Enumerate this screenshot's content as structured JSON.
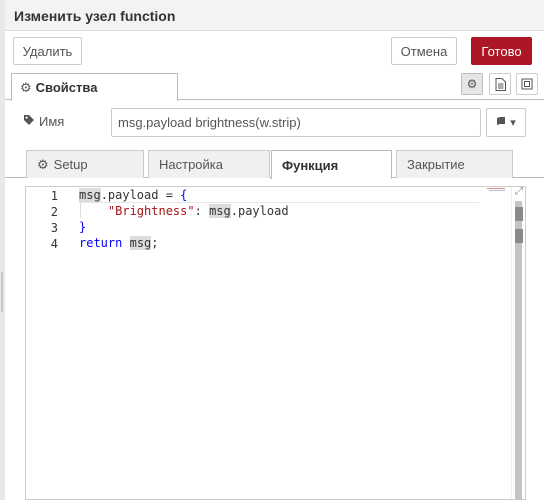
{
  "header": {
    "title": "Изменить узел function"
  },
  "toolbar": {
    "delete_label": "Удалить",
    "cancel_label": "Отмена",
    "done_label": "Готово"
  },
  "tabs": {
    "properties_label": "Свойства"
  },
  "properties": {
    "name_label": "Имя",
    "name_value": "msg.payload brightness(w.strip)"
  },
  "subtabs": [
    {
      "label": "Setup"
    },
    {
      "label": "Настройка"
    },
    {
      "label": "Функция"
    },
    {
      "label": "Закрытие"
    }
  ],
  "editor": {
    "lines": [
      {
        "number": "1"
      },
      {
        "number": "2"
      },
      {
        "number": "3"
      },
      {
        "number": "4"
      }
    ],
    "tokens": {
      "l1_msg": "msg",
      "l1_rest": ".payload = ",
      "l1_brace": "{",
      "l2_indent": "    ",
      "l2_key": "\"Brightness\"",
      "l2_colon": ": ",
      "l2_msg": "msg",
      "l2_rest": ".payload",
      "l3_brace": "}",
      "l4_return": "return",
      "l4_space": " ",
      "l4_msg": "msg",
      "l4_semi": ";"
    }
  },
  "colors": {
    "accent": "#ad1625",
    "keyword": "#0000ff",
    "string": "#a31515"
  },
  "icons": [
    "gear-icon",
    "tag-icon",
    "book-icon",
    "chevron-down-icon",
    "file-icon",
    "frame-icon",
    "expand-icon"
  ]
}
